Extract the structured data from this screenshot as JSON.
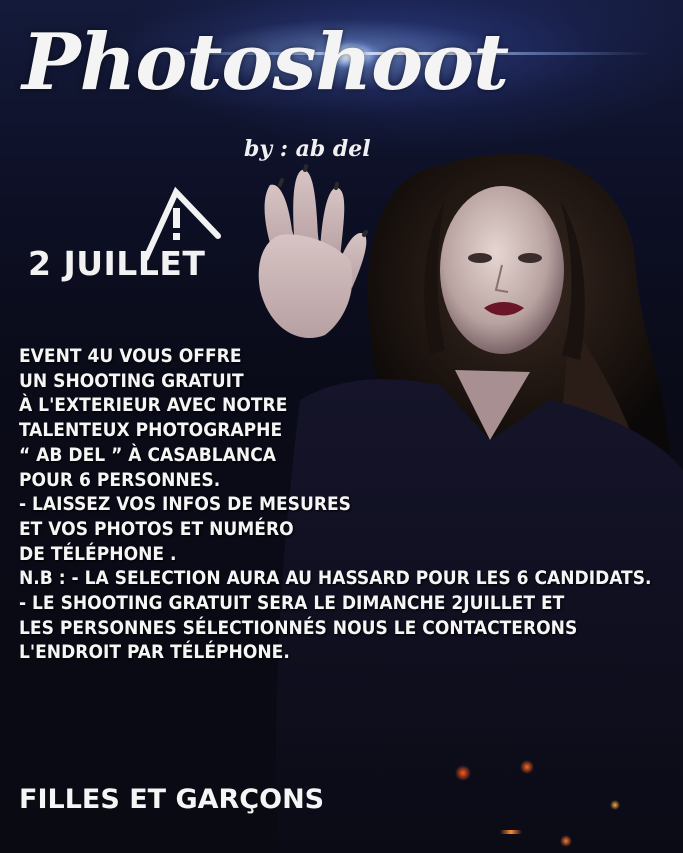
{
  "header": {
    "logo_text": "Photoshoot",
    "byline": "by : ab del"
  },
  "date": "2 JUILLET",
  "icons": {
    "warning": "warning-icon"
  },
  "body": {
    "lines": [
      "EVENT 4U VOUS OFFRE",
      "UN SHOOTING GRATUIT",
      "À L'EXTERIEUR AVEC NOTRE",
      "TALENTEUX PHOTOGRAPHE",
      "“ AB DEL ” À CASABLANCA",
      "POUR 6 PERSONNES.",
      "- LAISSEZ VOS INFOS DE MESURES",
      "ET VOS PHOTOS ET NUMÉRO",
      "DE TÉLÉPHONE .",
      "N.B : - LA SELECTION AURA AU HASSARD POUR LES 6 CANDIDATS.",
      "- LE SHOOTING GRATUIT SERA LE DIMANCHE 2JUILLET ET",
      "LES PERSONNES SÉLECTIONNÉS NOUS LE CONTACTERONS",
      "L'ENDROIT PAR TÉLÉPHONE."
    ]
  },
  "footer": "FILLES ET GARÇONS",
  "colors": {
    "text": "#f5f5f5",
    "background": "#0a0b14",
    "flare": "#b4c8ff"
  }
}
